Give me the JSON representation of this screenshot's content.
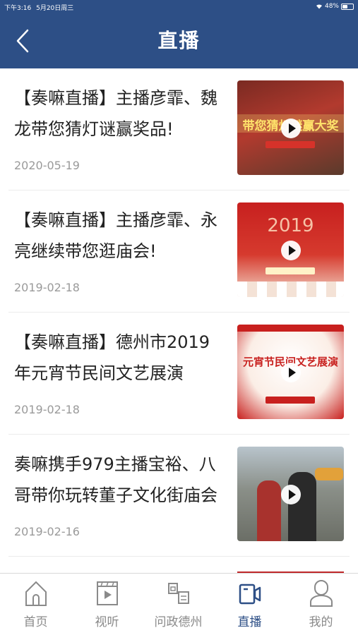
{
  "status_bar": {
    "time": "下午3:16",
    "date": "5月20日周三",
    "battery": "48%"
  },
  "header": {
    "title": "直播"
  },
  "items": [
    {
      "title": "【奏嘛直播】主播彦霏、魏龙带您猜灯谜赢奖品!",
      "date": "2020-05-19",
      "thumb_text": "带您猜灯谜赢大奖"
    },
    {
      "title": "【奏嘛直播】主播彦霏、永亮继续带您逛庙会!",
      "date": "2019-02-18",
      "thumb_text": "2019"
    },
    {
      "title": "【奏嘛直播】德州市2019年元宵节民间文艺展演",
      "date": "2019-02-18",
      "thumb_text": "元宵节民间文艺展演"
    },
    {
      "title": "奏嘛携手979主播宝裕、八哥带你玩转董子文化街庙会",
      "date": "2019-02-16",
      "thumb_text": ""
    }
  ],
  "tabs": [
    {
      "label": "首页",
      "icon": "home-icon",
      "active": false
    },
    {
      "label": "视听",
      "icon": "video-icon",
      "active": false
    },
    {
      "label": "问政德州",
      "icon": "wenzheng-icon",
      "active": false
    },
    {
      "label": "直播",
      "icon": "live-icon",
      "active": true
    },
    {
      "label": "我的",
      "icon": "user-icon",
      "active": false
    }
  ],
  "colors": {
    "header": "#2d4f86",
    "active_tab": "#2d4f86",
    "inactive_tab": "#8a8a8a"
  }
}
